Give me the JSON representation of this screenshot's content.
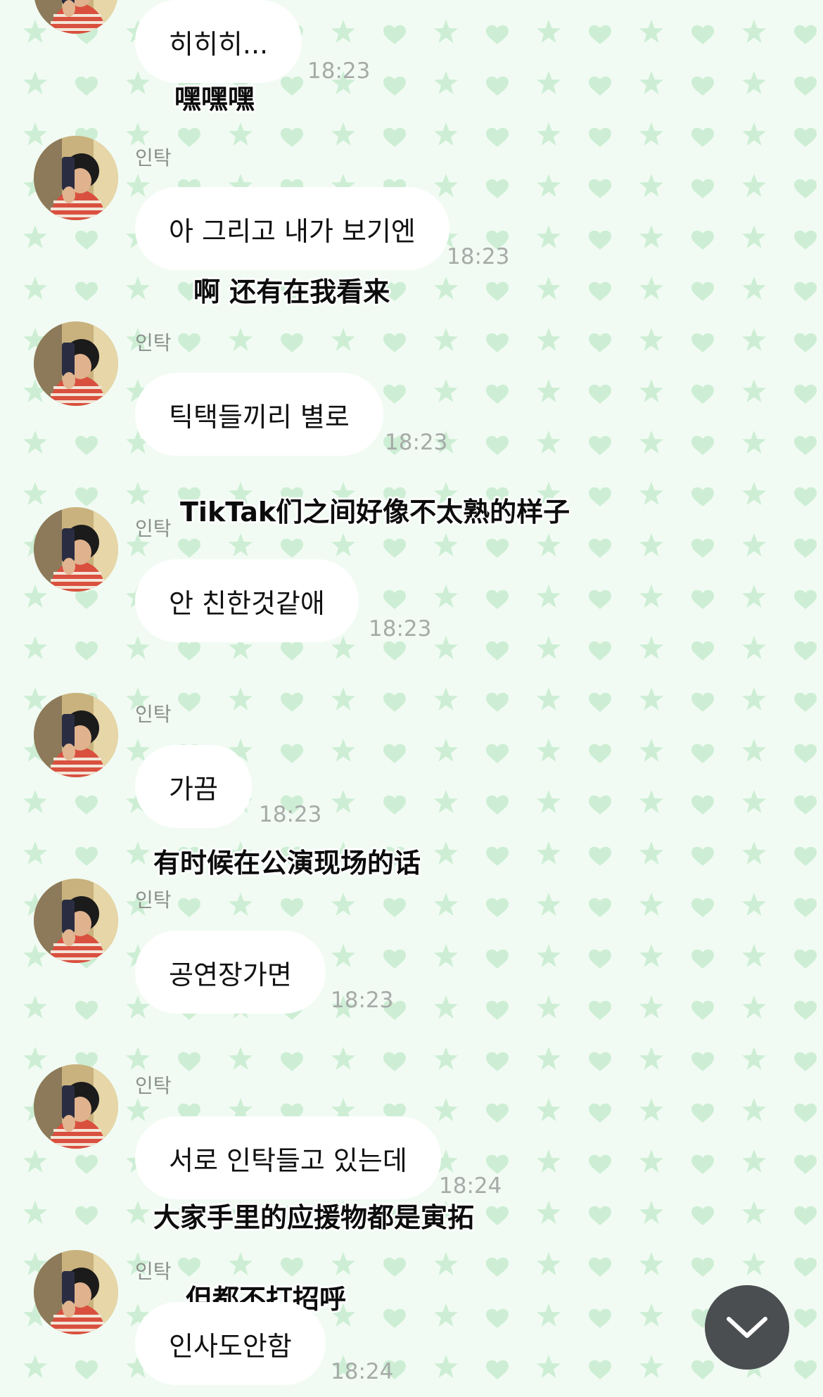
{
  "colors": {
    "background": "#f1fbf3",
    "pattern": "#cdeed4",
    "bubble": "#ffffff",
    "scroll_button": "#4a4e51"
  },
  "messages": [
    {
      "sender": "",
      "text": "히히히...",
      "time": "18:23",
      "caption": "嘿嘿嘿"
    },
    {
      "sender": "인탁",
      "text": "아 그리고 내가 보기엔",
      "time": "18:23",
      "caption": "啊 还有在我看来"
    },
    {
      "sender": "인탁",
      "text": "틱택들끼리 별로",
      "time": "18:23",
      "caption": "TikTak们之间好像不太熟的样子"
    },
    {
      "sender": "인탁",
      "text": "안 친한것같애",
      "time": "18:23",
      "caption": ""
    },
    {
      "sender": "인탁",
      "text": "가끔",
      "time": "18:23",
      "caption": "有时候在公演现场的话"
    },
    {
      "sender": "인탁",
      "text": "공연장가면",
      "time": "18:23",
      "caption": ""
    },
    {
      "sender": "인탁",
      "text": "서로 인탁들고 있는데",
      "time": "18:24",
      "caption": "大家手里的应援物都是寅拓"
    },
    {
      "sender": "인탁",
      "text": "인사도안함",
      "time": "18:24",
      "caption": "但都不打招呼"
    }
  ],
  "scroll_button_icon": "chevron-down-icon"
}
